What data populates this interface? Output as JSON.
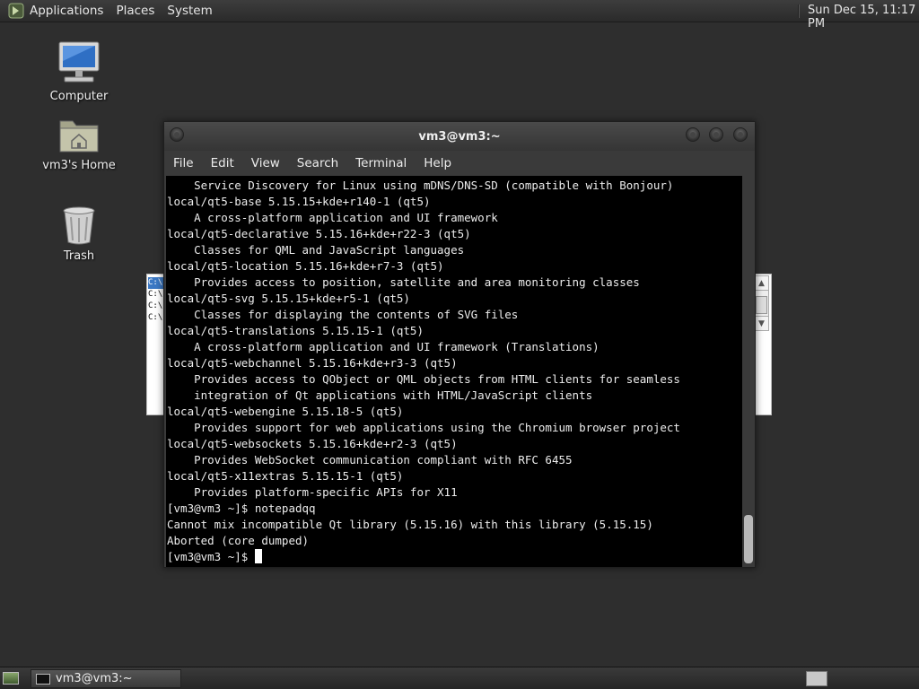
{
  "top_panel": {
    "menus": [
      "Applications",
      "Places",
      "System"
    ],
    "clock": "Sun Dec 15, 11:17 PM"
  },
  "desktop_icons": [
    {
      "label": "Computer",
      "icon": "computer-icon"
    },
    {
      "label": "vm3's Home",
      "icon": "home-folder-icon"
    },
    {
      "label": "Trash",
      "icon": "trash-icon"
    }
  ],
  "background_window": {
    "rows": [
      "C:\\",
      "C:\\",
      "C:\\",
      "C:\\"
    ]
  },
  "terminal": {
    "title": "vm3@vm3:~",
    "menus": [
      "File",
      "Edit",
      "View",
      "Search",
      "Terminal",
      "Help"
    ],
    "lines": [
      "    Service Discovery for Linux using mDNS/DNS-SD (compatible with Bonjour)",
      "local/qt5-base 5.15.15+kde+r140-1 (qt5)",
      "    A cross-platform application and UI framework",
      "local/qt5-declarative 5.15.16+kde+r22-3 (qt5)",
      "    Classes for QML and JavaScript languages",
      "local/qt5-location 5.15.16+kde+r7-3 (qt5)",
      "    Provides access to position, satellite and area monitoring classes",
      "local/qt5-svg 5.15.15+kde+r5-1 (qt5)",
      "    Classes for displaying the contents of SVG files",
      "local/qt5-translations 5.15.15-1 (qt5)",
      "    A cross-platform application and UI framework (Translations)",
      "local/qt5-webchannel 5.15.16+kde+r3-3 (qt5)",
      "    Provides access to QObject or QML objects from HTML clients for seamless",
      "    integration of Qt applications with HTML/JavaScript clients",
      "local/qt5-webengine 5.15.18-5 (qt5)",
      "    Provides support for web applications using the Chromium browser project",
      "local/qt5-websockets 5.15.16+kde+r2-3 (qt5)",
      "    Provides WebSocket communication compliant with RFC 6455",
      "local/qt5-x11extras 5.15.15-1 (qt5)",
      "    Provides platform-specific APIs for X11",
      "[vm3@vm3 ~]$ notepadqq",
      "Cannot mix incompatible Qt library (5.15.16) with this library (5.15.15)",
      "Aborted (core dumped)"
    ],
    "prompt": "[vm3@vm3 ~]$ "
  },
  "taskbar": {
    "task_label": "vm3@vm3:~"
  }
}
